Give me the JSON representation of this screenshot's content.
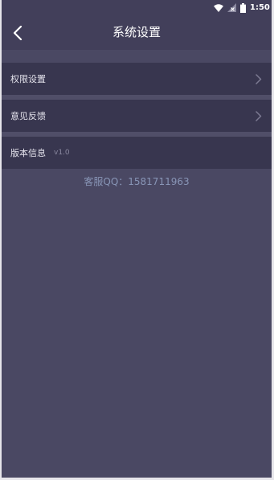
{
  "status_bar": {
    "time": "1:50",
    "icons": [
      "wifi-icon",
      "no-sim-signal-icon",
      "battery-icon"
    ]
  },
  "header": {
    "back_icon": "chevron-left-icon",
    "title": "系统设置"
  },
  "settings": {
    "items": [
      {
        "label": "权限设置",
        "icon": "chevron-right-icon"
      },
      {
        "label": "意见反馈",
        "icon": "chevron-right-icon"
      },
      {
        "label": "版本信息",
        "value": "v1.0"
      }
    ]
  },
  "support": {
    "qq": "客服QQ：1581711963"
  },
  "colors": {
    "page_bg": "#4a4863",
    "header_bg": "#423f5a",
    "row_bg": "#38364f",
    "row_gap": "#504e68",
    "text_primary": "#ffffff",
    "text_row": "#e4e3ec",
    "text_muted": "#8a889f",
    "arrow": "#7c7a92",
    "support_text": "#8895b6"
  }
}
